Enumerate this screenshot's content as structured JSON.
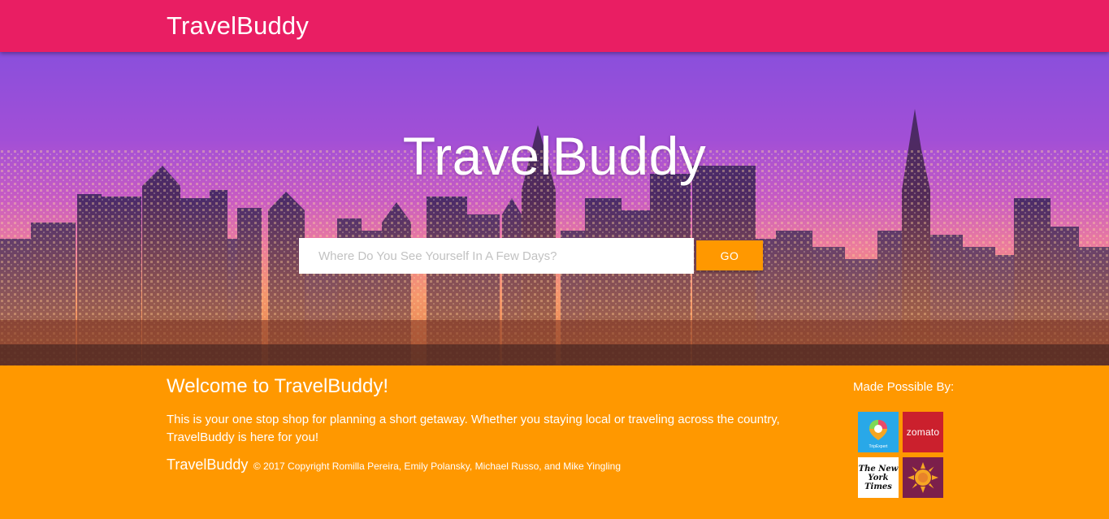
{
  "navbar": {
    "brand": "TravelBuddy"
  },
  "hero": {
    "title": "TravelBuddy",
    "search_placeholder": "Where Do You See Yourself In A Few Days?",
    "search_value": "",
    "go_label": "GO"
  },
  "footer": {
    "welcome_title": "Welcome to TravelBuddy!",
    "welcome_text": "This is your one stop shop for planning a short getaway. Whether you staying local or traveling across the country, TravelBuddy is here for you!",
    "copyright_brand": "TravelBuddy",
    "copyright_text": "© 2017 Copyright Romilla Pereira, Emily Polansky, Michael Russo, and Mike Yingling",
    "partners_title": "Made Possible By:",
    "partners": [
      {
        "name": "tripexpert",
        "label": "TripExpert",
        "color": "#29a8e8"
      },
      {
        "name": "zomato",
        "label": "zomato",
        "color": "#cb202d"
      },
      {
        "name": "nyt",
        "label": "The New York Times",
        "color": "#ffffff"
      },
      {
        "name": "sun",
        "label": "",
        "color": "#7b1f4b"
      }
    ]
  },
  "colors": {
    "navbar": "#e91e63",
    "accent": "#ff9800"
  }
}
